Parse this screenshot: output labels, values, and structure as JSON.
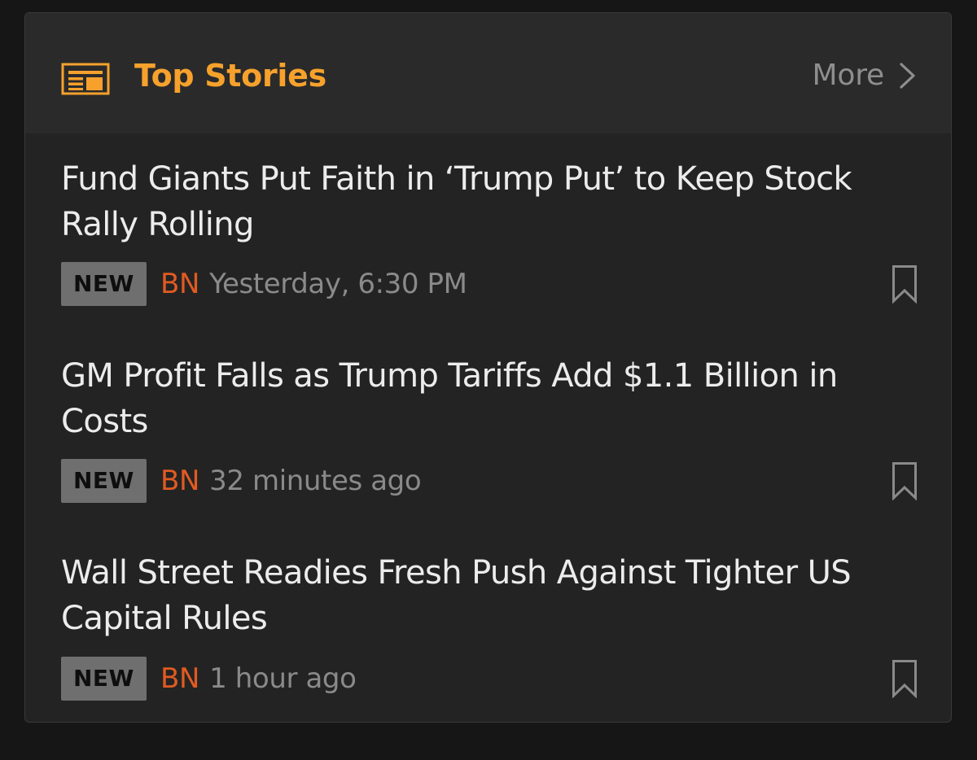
{
  "header": {
    "title": "Top Stories",
    "icon": "newspaper-icon",
    "more_label": "More",
    "more_icon": "chevron-right-icon"
  },
  "stories": [
    {
      "title": "Fund Giants Put Faith in ‘Trump Put’ to Keep Stock Rally Rolling",
      "badge": "NEW",
      "source": "BN",
      "time": "Yesterday, 6:30 PM",
      "bookmark_icon": "bookmark-icon"
    },
    {
      "title": "GM Profit Falls as Trump Tariffs Add $1.1 Billion in Costs",
      "badge": "NEW",
      "source": "BN",
      "time": "32 minutes ago",
      "bookmark_icon": "bookmark-icon"
    },
    {
      "title": "Wall Street Readies Fresh Push Against Tighter US Capital Rules",
      "badge": "NEW",
      "source": "BN",
      "time": "1 hour ago",
      "bookmark_icon": "bookmark-icon"
    }
  ],
  "colors": {
    "accent": "#f7a12c",
    "source": "#e05b22",
    "badge_bg": "#6f6f6f",
    "card_bg": "#232323",
    "header_bg": "#2a2a2a",
    "page_bg": "#161616"
  }
}
